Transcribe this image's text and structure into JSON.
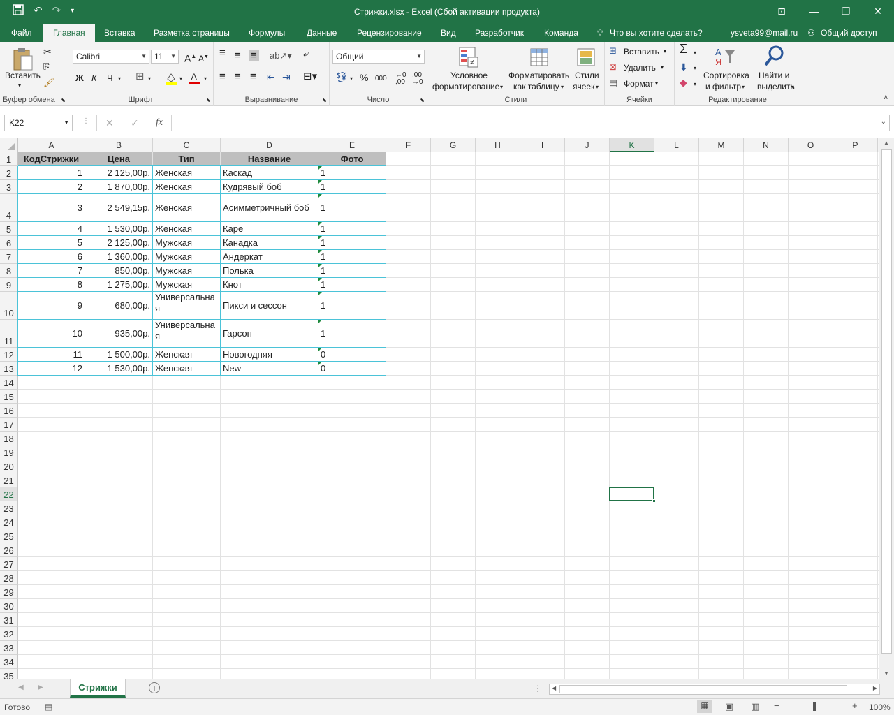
{
  "titlebar": {
    "title": "Стрижки.xlsx - Excel (Сбой активации продукта)",
    "qat": [
      "save-icon",
      "undo-icon",
      "redo-icon",
      "customize-icon"
    ],
    "win": {
      "ribbon_opts": "⊡",
      "restore": "❐",
      "close": "✕"
    }
  },
  "tabs": [
    "Файл",
    "Главная",
    "Вставка",
    "Разметка страницы",
    "Формулы",
    "Данные",
    "Рецензирование",
    "Вид",
    "Разработчик",
    "Команда"
  ],
  "tell_me": "Что вы хотите сделать?",
  "account": "ysveta99@mail.ru",
  "share": "Общий доступ",
  "ribbon": {
    "clipboard": {
      "paste": "Вставить",
      "label": "Буфер обмена"
    },
    "font": {
      "name": "Calibri",
      "size": "11",
      "bold": "Ж",
      "italic": "К",
      "underline": "Ч",
      "label": "Шрифт"
    },
    "alignment": {
      "label": "Выравнивание"
    },
    "number": {
      "format": "Общий",
      "percent": "%",
      "thousands": "000",
      "label": "Число"
    },
    "styles": {
      "conditional1": "Условное",
      "conditional2": "форматирование",
      "table1": "Форматировать",
      "table2": "как таблицу",
      "cell1": "Стили",
      "cell2": "ячеек",
      "label": "Стили"
    },
    "cells": {
      "insert": "Вставить",
      "delete": "Удалить",
      "format": "Формат",
      "label": "Ячейки"
    },
    "editing": {
      "sort1": "Сортировка",
      "sort2": "и фильтр",
      "find1": "Найти и",
      "find2": "выделить",
      "label": "Редактирование"
    }
  },
  "formula_bar": {
    "name_box": "K22",
    "formula": ""
  },
  "columns": [
    "A",
    "B",
    "C",
    "D",
    "E",
    "F",
    "G",
    "H",
    "I",
    "J",
    "K",
    "L",
    "M",
    "N",
    "O",
    "P"
  ],
  "selected_column": "K",
  "selected_row": 22,
  "table": {
    "headers": [
      "КодСтрижки",
      "Цена",
      "Тип",
      "Название",
      "Фото"
    ],
    "rows": [
      [
        "1",
        "2 125,00р.",
        "Женская",
        "Каскад",
        "1"
      ],
      [
        "2",
        "1 870,00р.",
        "Женская",
        "Кудрявый боб",
        "1"
      ],
      [
        "3",
        "2 549,15р.",
        "Женская",
        "Асимметричный боб",
        "1"
      ],
      [
        "4",
        "1 530,00р.",
        "Женская",
        "Каре",
        "1"
      ],
      [
        "5",
        "2 125,00р.",
        "Мужская",
        "Канадка",
        "1"
      ],
      [
        "6",
        "1 360,00р.",
        "Мужская",
        "Андеркат",
        "1"
      ],
      [
        "7",
        "850,00р.",
        "Мужская",
        "Полька",
        "1"
      ],
      [
        "8",
        "1 275,00р.",
        "Мужская",
        "Кнот",
        "1"
      ],
      [
        "9",
        "680,00р.",
        "Универсальная",
        "Пикси и сессон",
        "1"
      ],
      [
        "10",
        "935,00р.",
        "Универсальная",
        "Гарсон",
        "1"
      ],
      [
        "11",
        "1 500,00р.",
        "Женская",
        "Новогодняя",
        "0"
      ],
      [
        "12",
        "1 530,00р.",
        "Женская",
        "New",
        "0"
      ]
    ]
  },
  "sheet_tab": "Стрижки",
  "status": {
    "ready": "Готово",
    "zoom": "100%"
  }
}
